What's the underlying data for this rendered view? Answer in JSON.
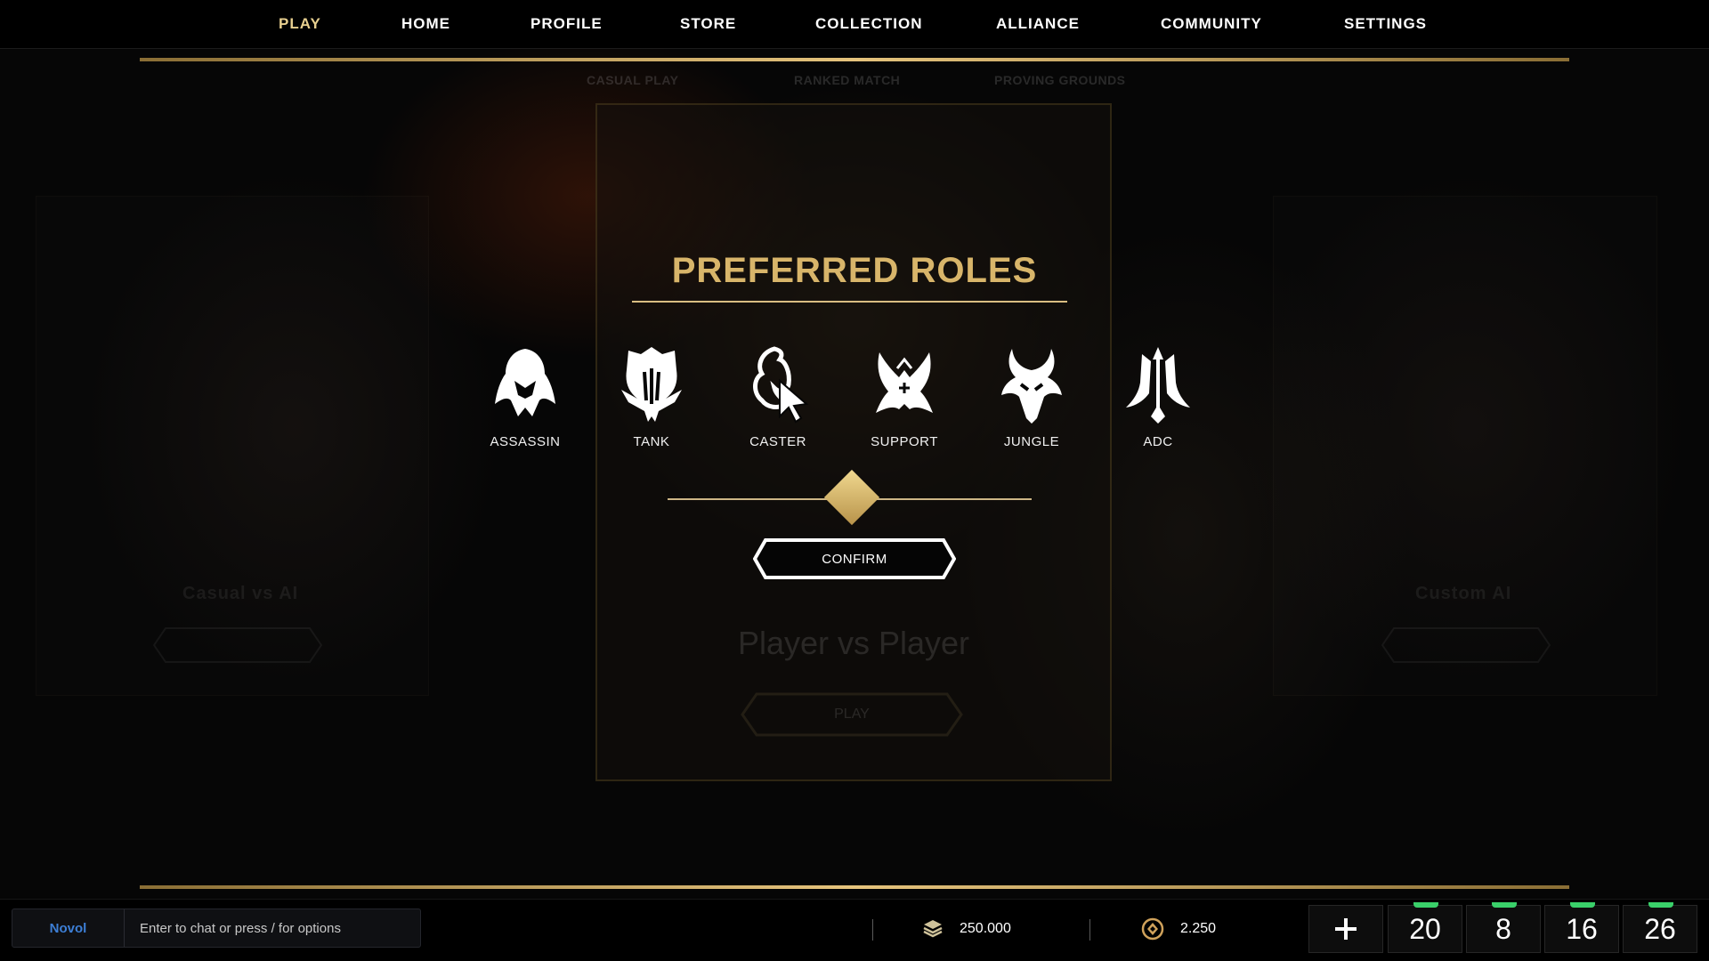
{
  "nav": {
    "items": [
      {
        "label": "PLAY",
        "active": true
      },
      {
        "label": "HOME"
      },
      {
        "label": "PROFILE"
      },
      {
        "label": "STORE"
      },
      {
        "label": "COLLECTION"
      },
      {
        "label": "ALLIANCE"
      },
      {
        "label": "COMMUNITY"
      },
      {
        "label": "SETTINGS"
      }
    ]
  },
  "subtabs": [
    "CASUAL PLAY",
    "RANKED MATCH",
    "PROVING GROUNDS"
  ],
  "background": {
    "left_card_title": "Casual vs AI",
    "right_card_title": "Custom AI",
    "center_card_title": "Player vs Player",
    "center_card_button": "PLAY"
  },
  "modal": {
    "title": "PREFERRED ROLES",
    "roles": [
      {
        "label": "ASSASSIN",
        "icon": "assassin-icon"
      },
      {
        "label": "TANK",
        "icon": "tank-icon"
      },
      {
        "label": "CASTER",
        "icon": "caster-icon"
      },
      {
        "label": "SUPPORT",
        "icon": "support-icon"
      },
      {
        "label": "JUNGLE",
        "icon": "jungle-icon"
      },
      {
        "label": "ADC",
        "icon": "adc-icon"
      }
    ],
    "confirm_label": "CONFIRM"
  },
  "chat": {
    "username": "Novol",
    "placeholder": "Enter to chat or press / for options"
  },
  "currencies": [
    {
      "icon": "stacked-coins-icon",
      "value": "250.000"
    },
    {
      "icon": "premium-coin-icon",
      "value": "2.250"
    }
  ],
  "counters": [
    "20",
    "8",
    "16",
    "26"
  ],
  "colors": {
    "gold": "#d8b56a",
    "active_nav": "#e7cf8f",
    "chat_name": "#3d7fd6",
    "counter_pip": "#3ad06a"
  }
}
